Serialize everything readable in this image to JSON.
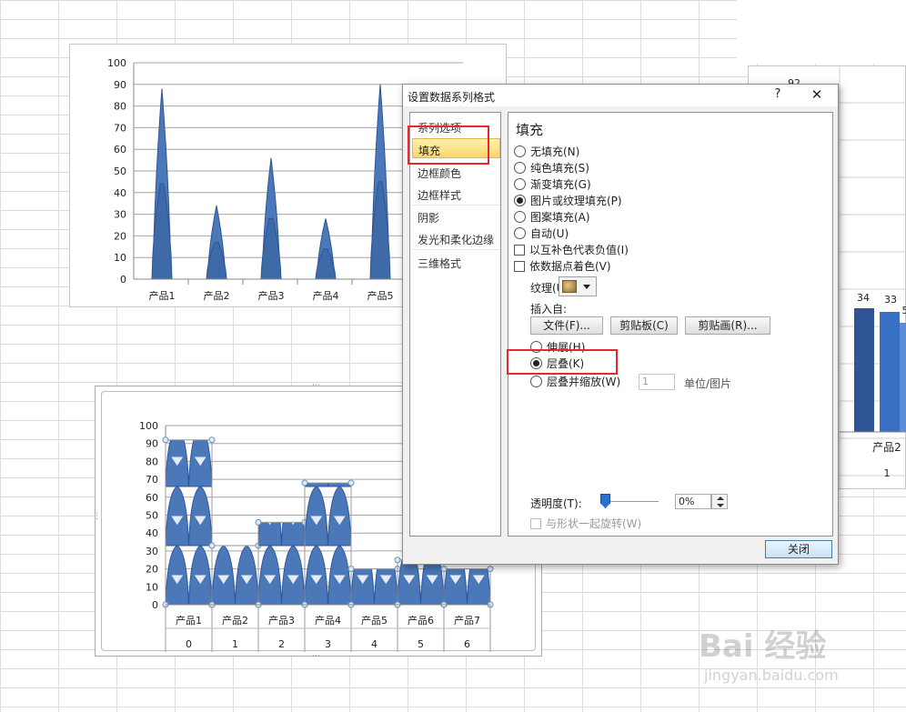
{
  "chart_data": [
    {
      "type": "bar",
      "title": "",
      "categories": [
        "产品1",
        "产品2",
        "产品3",
        "产品4",
        "产品5"
      ],
      "values": [
        88,
        34,
        56,
        28,
        90
      ],
      "ylim": [
        0,
        100
      ],
      "yticks": [
        "0",
        "10",
        "20",
        "30",
        "40",
        "50",
        "60",
        "70",
        "80",
        "90",
        "100"
      ],
      "grid": true,
      "color": "#4a78b8"
    },
    {
      "type": "bar",
      "title": "",
      "categories": [
        "产品1",
        "产品2",
        "产品3",
        "产品4",
        "产品5",
        "产品6",
        "产品7"
      ],
      "x_numbers": [
        "0",
        "1",
        "2",
        "3",
        "4",
        "5",
        "6"
      ],
      "values": [
        92,
        33,
        46,
        68,
        20,
        25,
        20
      ],
      "ylim": [
        0,
        100
      ],
      "yticks": [
        "0",
        "10",
        "20",
        "30",
        "40",
        "50",
        "60",
        "70",
        "80",
        "90",
        "100"
      ],
      "grid": true,
      "color": "#4a78b8"
    },
    {
      "type": "bar",
      "title": "",
      "categories": [
        "产品2"
      ],
      "x_numbers": [
        "1"
      ],
      "data_labels": [
        "92",
        "34",
        "33",
        "5"
      ],
      "values": [
        34,
        33
      ],
      "color": "#2f5597"
    }
  ],
  "dialog": {
    "title": "设置数据系列格式",
    "help": "?",
    "close_icon": "close-icon",
    "nav": [
      "系列选项",
      "填充",
      "边框颜色",
      "边框样式",
      "阴影",
      "发光和柔化边缘",
      "三维格式"
    ],
    "panel_title": "填充",
    "fill_options": [
      "无填充(N)",
      "纯色填充(S)",
      "渐变填充(G)",
      "图片或纹理填充(P)",
      "图案填充(A)",
      "自动(U)"
    ],
    "selected_fill": "图片或纹理填充(P)",
    "checkboxes": [
      "以互补色代表负值(I)",
      "依数据点着色(V)"
    ],
    "texture_label": "纹理(U):",
    "insert_from": "插入自:",
    "buttons": [
      "文件(F)...",
      "剪贴板(C)",
      "剪贴画(R)..."
    ],
    "stack_options": [
      "伸展(H)",
      "层叠(K)",
      "层叠并缩放(W)"
    ],
    "selected_stack": "层叠(K)",
    "units_value": "1",
    "units_label": "单位/图片",
    "transparency_label": "透明度(T):",
    "transparency_value": "0%",
    "rotate_label": "与形状一起旋转(W)",
    "close_button": "关闭"
  },
  "watermark": {
    "main": "Bai 经验",
    "sub": "jingyan.baidu.com"
  }
}
